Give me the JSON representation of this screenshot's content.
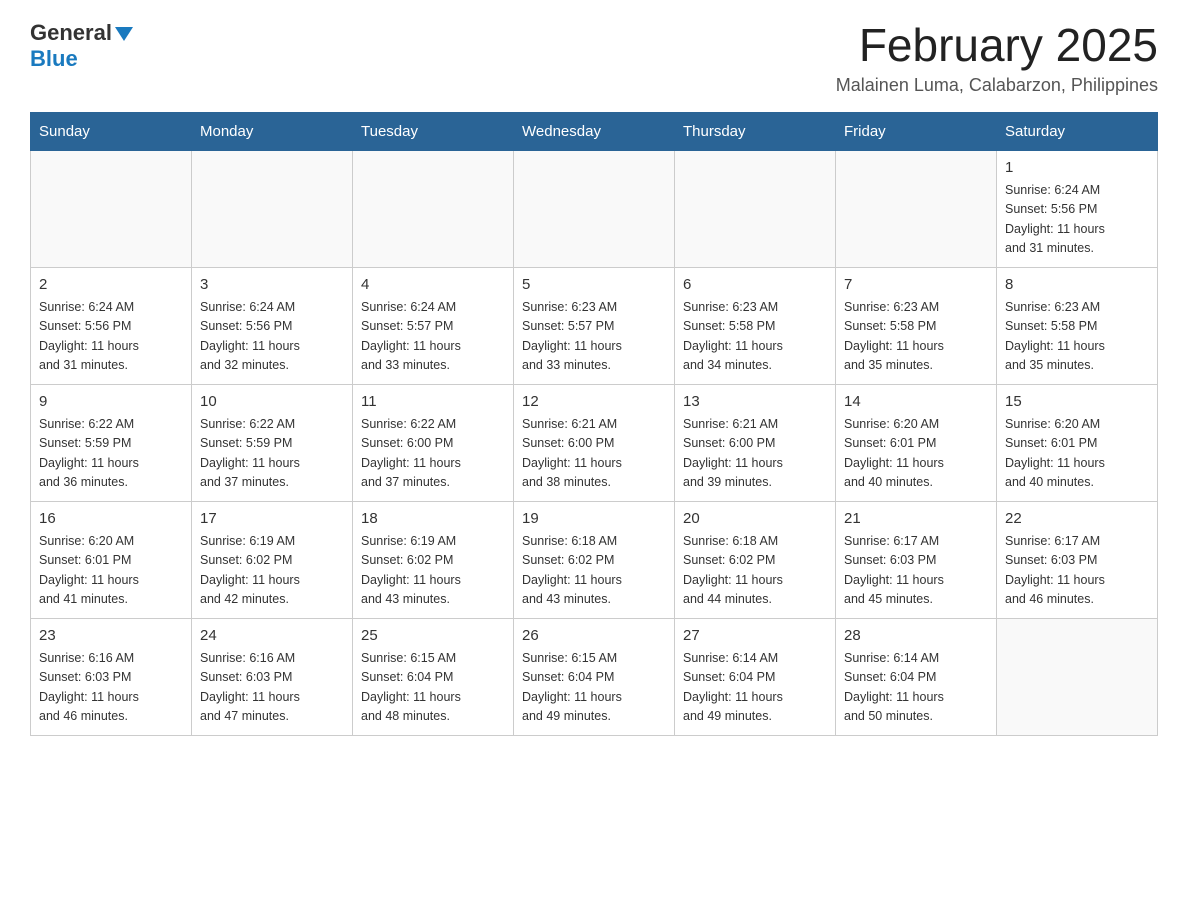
{
  "header": {
    "logo_general": "General",
    "logo_blue": "Blue",
    "title": "February 2025",
    "subtitle": "Malainen Luma, Calabarzon, Philippines"
  },
  "calendar": {
    "days_of_week": [
      "Sunday",
      "Monday",
      "Tuesday",
      "Wednesday",
      "Thursday",
      "Friday",
      "Saturday"
    ],
    "weeks": [
      [
        {
          "day": "",
          "info": ""
        },
        {
          "day": "",
          "info": ""
        },
        {
          "day": "",
          "info": ""
        },
        {
          "day": "",
          "info": ""
        },
        {
          "day": "",
          "info": ""
        },
        {
          "day": "",
          "info": ""
        },
        {
          "day": "1",
          "info": "Sunrise: 6:24 AM\nSunset: 5:56 PM\nDaylight: 11 hours\nand 31 minutes."
        }
      ],
      [
        {
          "day": "2",
          "info": "Sunrise: 6:24 AM\nSunset: 5:56 PM\nDaylight: 11 hours\nand 31 minutes."
        },
        {
          "day": "3",
          "info": "Sunrise: 6:24 AM\nSunset: 5:56 PM\nDaylight: 11 hours\nand 32 minutes."
        },
        {
          "day": "4",
          "info": "Sunrise: 6:24 AM\nSunset: 5:57 PM\nDaylight: 11 hours\nand 33 minutes."
        },
        {
          "day": "5",
          "info": "Sunrise: 6:23 AM\nSunset: 5:57 PM\nDaylight: 11 hours\nand 33 minutes."
        },
        {
          "day": "6",
          "info": "Sunrise: 6:23 AM\nSunset: 5:58 PM\nDaylight: 11 hours\nand 34 minutes."
        },
        {
          "day": "7",
          "info": "Sunrise: 6:23 AM\nSunset: 5:58 PM\nDaylight: 11 hours\nand 35 minutes."
        },
        {
          "day": "8",
          "info": "Sunrise: 6:23 AM\nSunset: 5:58 PM\nDaylight: 11 hours\nand 35 minutes."
        }
      ],
      [
        {
          "day": "9",
          "info": "Sunrise: 6:22 AM\nSunset: 5:59 PM\nDaylight: 11 hours\nand 36 minutes."
        },
        {
          "day": "10",
          "info": "Sunrise: 6:22 AM\nSunset: 5:59 PM\nDaylight: 11 hours\nand 37 minutes."
        },
        {
          "day": "11",
          "info": "Sunrise: 6:22 AM\nSunset: 6:00 PM\nDaylight: 11 hours\nand 37 minutes."
        },
        {
          "day": "12",
          "info": "Sunrise: 6:21 AM\nSunset: 6:00 PM\nDaylight: 11 hours\nand 38 minutes."
        },
        {
          "day": "13",
          "info": "Sunrise: 6:21 AM\nSunset: 6:00 PM\nDaylight: 11 hours\nand 39 minutes."
        },
        {
          "day": "14",
          "info": "Sunrise: 6:20 AM\nSunset: 6:01 PM\nDaylight: 11 hours\nand 40 minutes."
        },
        {
          "day": "15",
          "info": "Sunrise: 6:20 AM\nSunset: 6:01 PM\nDaylight: 11 hours\nand 40 minutes."
        }
      ],
      [
        {
          "day": "16",
          "info": "Sunrise: 6:20 AM\nSunset: 6:01 PM\nDaylight: 11 hours\nand 41 minutes."
        },
        {
          "day": "17",
          "info": "Sunrise: 6:19 AM\nSunset: 6:02 PM\nDaylight: 11 hours\nand 42 minutes."
        },
        {
          "day": "18",
          "info": "Sunrise: 6:19 AM\nSunset: 6:02 PM\nDaylight: 11 hours\nand 43 minutes."
        },
        {
          "day": "19",
          "info": "Sunrise: 6:18 AM\nSunset: 6:02 PM\nDaylight: 11 hours\nand 43 minutes."
        },
        {
          "day": "20",
          "info": "Sunrise: 6:18 AM\nSunset: 6:02 PM\nDaylight: 11 hours\nand 44 minutes."
        },
        {
          "day": "21",
          "info": "Sunrise: 6:17 AM\nSunset: 6:03 PM\nDaylight: 11 hours\nand 45 minutes."
        },
        {
          "day": "22",
          "info": "Sunrise: 6:17 AM\nSunset: 6:03 PM\nDaylight: 11 hours\nand 46 minutes."
        }
      ],
      [
        {
          "day": "23",
          "info": "Sunrise: 6:16 AM\nSunset: 6:03 PM\nDaylight: 11 hours\nand 46 minutes."
        },
        {
          "day": "24",
          "info": "Sunrise: 6:16 AM\nSunset: 6:03 PM\nDaylight: 11 hours\nand 47 minutes."
        },
        {
          "day": "25",
          "info": "Sunrise: 6:15 AM\nSunset: 6:04 PM\nDaylight: 11 hours\nand 48 minutes."
        },
        {
          "day": "26",
          "info": "Sunrise: 6:15 AM\nSunset: 6:04 PM\nDaylight: 11 hours\nand 49 minutes."
        },
        {
          "day": "27",
          "info": "Sunrise: 6:14 AM\nSunset: 6:04 PM\nDaylight: 11 hours\nand 49 minutes."
        },
        {
          "day": "28",
          "info": "Sunrise: 6:14 AM\nSunset: 6:04 PM\nDaylight: 11 hours\nand 50 minutes."
        },
        {
          "day": "",
          "info": ""
        }
      ]
    ]
  }
}
